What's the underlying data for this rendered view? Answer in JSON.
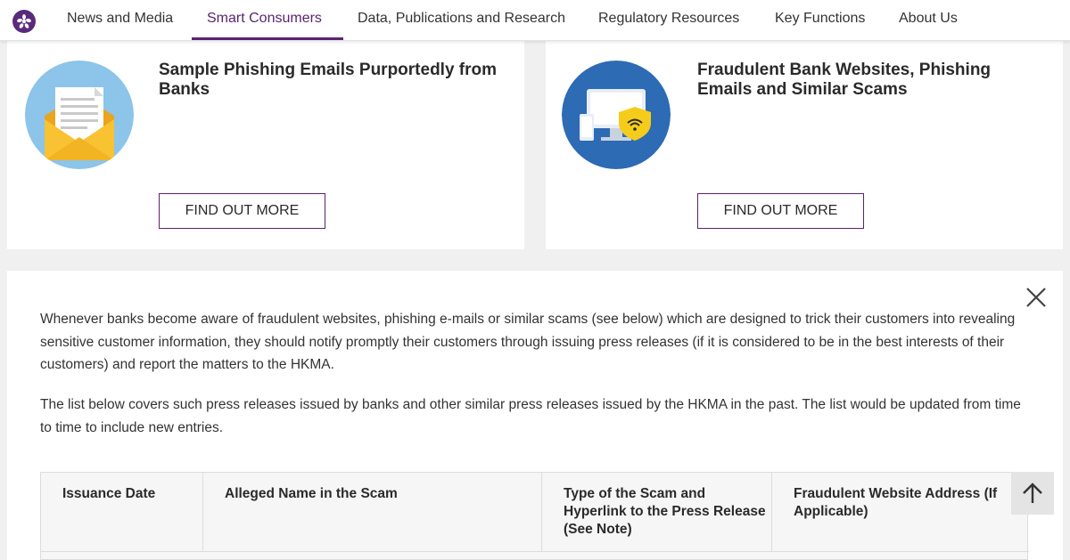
{
  "nav": {
    "items": [
      {
        "label": "News and Media"
      },
      {
        "label": "Smart Consumers",
        "active": true
      },
      {
        "label": "Data, Publications and Research"
      },
      {
        "label": "Regulatory Resources"
      },
      {
        "label": "Key Functions"
      },
      {
        "label": "About Us"
      }
    ],
    "logo_icon": "hkma-logo-icon"
  },
  "cards": [
    {
      "title": "Sample Phishing Emails Purportedly from Banks",
      "button_label": "FIND OUT MORE",
      "icon": "envelope-letter-icon"
    },
    {
      "title": "Fraudulent Bank Websites, Phishing Emails and Similar Scams",
      "button_label": "FIND OUT MORE",
      "icon": "devices-shield-wifi-icon"
    }
  ],
  "info": {
    "paragraph1": "Whenever banks become aware of fraudulent websites, phishing e-mails or similar scams (see below) which are designed to trick their customers into revealing sensitive customer information, they should notify promptly their customers through issuing press releases (if it is considered to be in the best interests of their customers) and report the matters to the HKMA.",
    "paragraph2": "The list below covers such press releases issued by banks and other similar press releases issued by the HKMA in the past. The list would be updated from time to time to include new entries.",
    "table_headers": [
      "Issuance Date",
      "Alleged Name in the Scam",
      "Type of the Scam and Hyperlink to the Press Release (See Note)",
      "Fraudulent Website Address (If Applicable)"
    ]
  },
  "colors": {
    "accent": "#5a2370",
    "envelope_circle": "#8cc4ea",
    "devices_circle": "#2d6bb4",
    "shield": "#f5cc1a"
  }
}
